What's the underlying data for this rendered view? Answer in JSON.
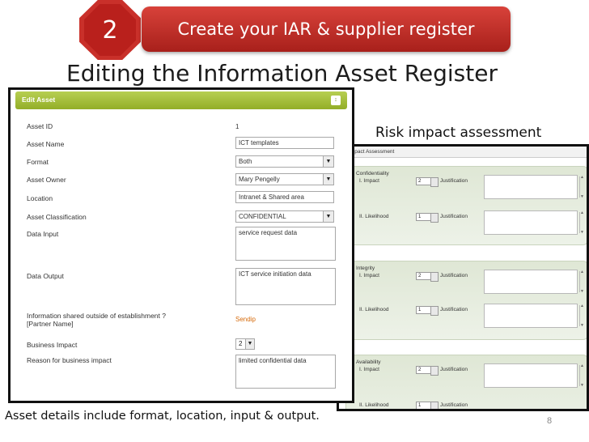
{
  "banner": {
    "step_number": "2",
    "step_title": "Create your IAR & supplier register"
  },
  "slide_title": "Editing the Information Asset Register",
  "risk_label": "Risk impact assessment",
  "caption": "Asset details include format, location, input & output.",
  "page_number": "8",
  "edit_asset": {
    "header": "Edit Asset",
    "collapse_icon": "collapse-icon",
    "asset_id_label": "Asset ID",
    "asset_id_value": "1",
    "asset_name_label": "Asset Name",
    "asset_name_value": "ICT templates",
    "format_label": "Format",
    "format_value": "Both",
    "asset_owner_label": "Asset Owner",
    "asset_owner_value": "Mary Pengelly",
    "location_label": "Location",
    "location_value": "Intranet & Shared area",
    "classification_label": "Asset Classification",
    "classification_value": "CONFIDENTIAL",
    "data_input_label": "Data Input",
    "data_input_value": "service request data",
    "data_output_label": "Data Output",
    "data_output_value": "ICT service initiation data",
    "shared_label_1": "Information shared outside of establishment ?",
    "shared_label_2": "[Partner Name]",
    "shared_value": "Sendip",
    "business_impact_label": "Business Impact",
    "business_impact_value": "2",
    "reason_label": "Reason for business impact",
    "reason_value": "limited confidential data"
  },
  "risk_panel": {
    "header": "Impact Assessment",
    "sections": [
      {
        "title": "A. Confidentiality",
        "rows": [
          {
            "label": "I. Impact",
            "value": "2",
            "justification_label": "Justification"
          },
          {
            "label": "II. Likelihood",
            "value": "1",
            "justification_label": "Justification"
          }
        ]
      },
      {
        "title": "B. Integrity",
        "rows": [
          {
            "label": "I. Impact",
            "value": "2",
            "justification_label": "Justification"
          },
          {
            "label": "II. Likelihood",
            "value": "1",
            "justification_label": "Justification"
          }
        ]
      },
      {
        "title": "C. Availability",
        "rows": [
          {
            "label": "I. Impact",
            "value": "2",
            "justification_label": "Justification"
          },
          {
            "label": "II. Likelihood",
            "value": "1",
            "justification_label": "Justification"
          }
        ]
      }
    ]
  }
}
